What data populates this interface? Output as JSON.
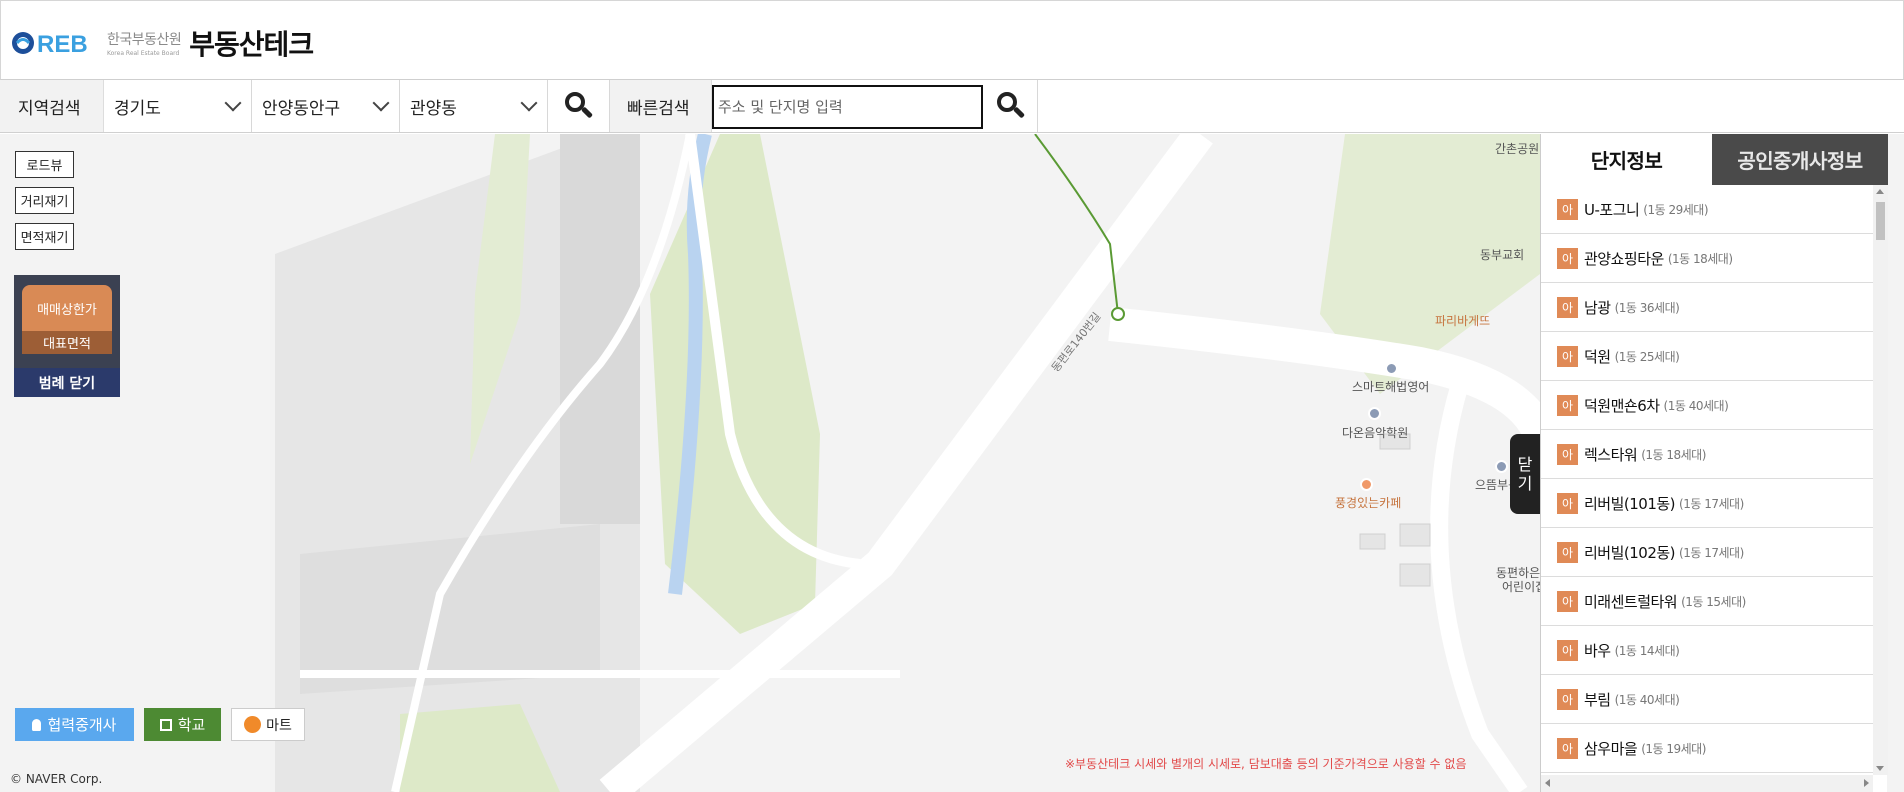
{
  "header": {
    "logo_text": "REB",
    "logo_kr": "한국부동산원",
    "logo_en": "Korea Real Estate Board",
    "brand": "부동산테크"
  },
  "search": {
    "region_label": "지역검색",
    "province": "경기도",
    "district": "안양동안구",
    "dong": "관양동",
    "quick_label": "빠른검색",
    "quick_placeholder": "주소 및 단지명 입력"
  },
  "map": {
    "buttons": {
      "roadview": "로드뷰",
      "distance": "거리재기",
      "area": "면적재기"
    },
    "legend": {
      "price": "매매상한가",
      "area": "대표면적",
      "close": "범례 닫기"
    },
    "layers": {
      "broker": "협력중개사",
      "school": "학교",
      "mart": "마트"
    },
    "copyright": "© NAVER Corp.",
    "disclaimer": "※부동산테크 시세와 별개의 시세로, 담보대출 등의 기준가격으로 사용할 수 없음",
    "close_tab": "닫기",
    "road_label": "동편로140번길",
    "pois": {
      "park": "간촌공원",
      "church": "동부교회",
      "bakery": "파리바게뜨",
      "english": "스마트해법영어",
      "music": "다온음악학원",
      "realty": "으뜸부동산",
      "cafe": "풍경있는카페",
      "kindergarten_1": "동편하은",
      "kindergarten_2": "어린이집"
    }
  },
  "panel": {
    "tab_complex": "단지정보",
    "tab_broker": "공인중개사정보",
    "badge": "아",
    "items": [
      {
        "name": "U-포그니",
        "meta": "(1동 29세대)"
      },
      {
        "name": "관양쇼핑타운",
        "meta": "(1동 18세대)"
      },
      {
        "name": "남광",
        "meta": "(1동 36세대)"
      },
      {
        "name": "덕원",
        "meta": "(1동 25세대)"
      },
      {
        "name": "덕원맨숀6차",
        "meta": "(1동 40세대)"
      },
      {
        "name": "렉스타워",
        "meta": "(1동 18세대)"
      },
      {
        "name": "리버빌(101동)",
        "meta": "(1동 17세대)"
      },
      {
        "name": "리버빌(102동)",
        "meta": "(1동 17세대)"
      },
      {
        "name": "미래센트럴타워",
        "meta": "(1동 15세대)"
      },
      {
        "name": "바우",
        "meta": "(1동 14세대)"
      },
      {
        "name": "부림",
        "meta": "(1동 40세대)"
      },
      {
        "name": "삼우마을",
        "meta": "(1동 19세대)"
      }
    ]
  },
  "colors": {
    "badge": "#e08a56",
    "legend_price": "#d98a55",
    "legend_area": "#9d5e36",
    "legend_close": "#2b3a6b",
    "broker_btn": "#5aa8ee",
    "school_btn": "#4d8a33",
    "disclaimer": "#e24a4a"
  }
}
